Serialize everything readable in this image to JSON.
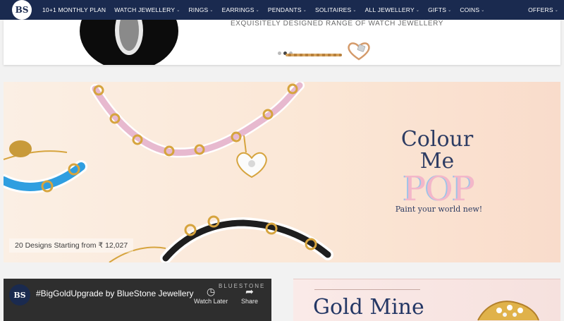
{
  "nav": {
    "logo": "BS",
    "items": [
      {
        "label": "10+1 MONTHLY PLAN",
        "dropdown": false
      },
      {
        "label": "WATCH JEWELLERY",
        "dropdown": true
      },
      {
        "label": "RINGS",
        "dropdown": true
      },
      {
        "label": "EARRINGS",
        "dropdown": true
      },
      {
        "label": "PENDANTS",
        "dropdown": true
      },
      {
        "label": "SOLITAIRES",
        "dropdown": true
      },
      {
        "label": "ALL JEWELLERY",
        "dropdown": true
      },
      {
        "label": "GIFTS",
        "dropdown": true
      },
      {
        "label": "COINS",
        "dropdown": true
      }
    ],
    "right": {
      "label": "OFFERS",
      "dropdown": true
    },
    "bg_color": "#1a2a4f"
  },
  "top_card": {
    "tagline": "EXQUISITELY DESIGNED RANGE OF WATCH JEWELLERY",
    "dots": 3,
    "active_dot": 2
  },
  "banner": {
    "headline_1": "Colour",
    "headline_2": "Me",
    "pop": "POP",
    "subline": "Paint your world new!",
    "caption": "20 Designs Starting from ₹ 12,027",
    "title_color": "#2d3c63"
  },
  "video": {
    "avatar": "BS",
    "title": "#BigGoldUpgrade by BlueStone Jewellery",
    "brand": "BLUESTONE",
    "watch_later": "Watch Later",
    "share": "Share"
  },
  "gold_card": {
    "title": "Gold Mine"
  }
}
